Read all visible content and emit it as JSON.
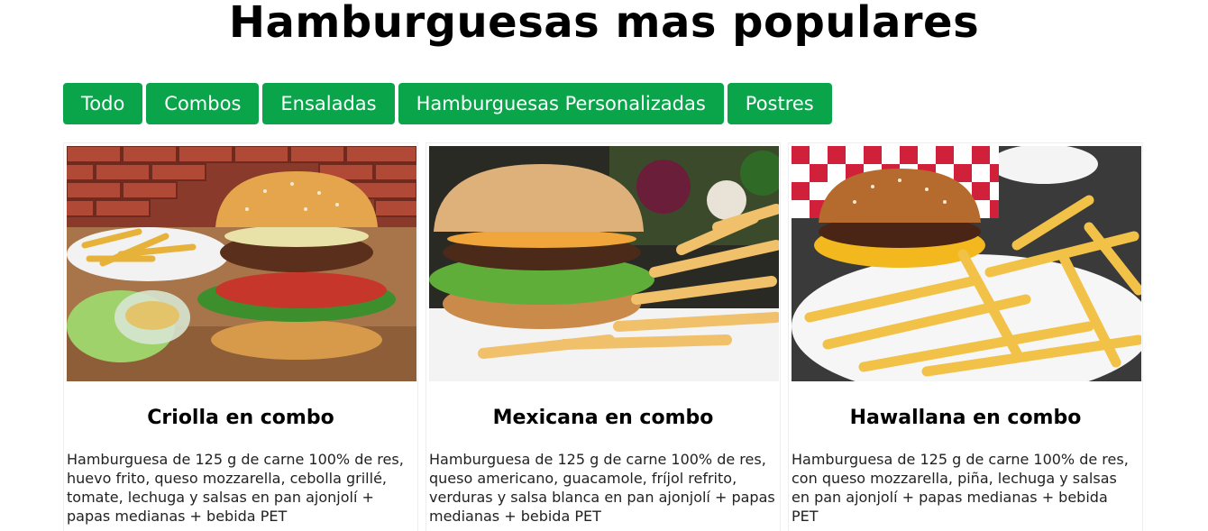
{
  "page": {
    "title": "Hamburguesas mas populares"
  },
  "filters": [
    {
      "label": "Todo"
    },
    {
      "label": "Combos"
    },
    {
      "label": "Ensaladas"
    },
    {
      "label": "Hamburguesas Personalizadas"
    },
    {
      "label": "Postres"
    }
  ],
  "cards": [
    {
      "title": "Criolla en combo",
      "description": "Hamburguesa de 125 g de carne 100% de res, huevo frito, queso mozzarella, cebolla grillé, tomate, lechuga y salsas en pan ajonjolí + papas medianas + bebida PET",
      "image": "burger-brick-wall-photo"
    },
    {
      "title": "Mexicana en combo",
      "description": "Hamburguesa de 125 g de carne 100% de res, queso americano, guacamole, fríjol refrito, verduras y salsa blanca en pan ajonjolí + papas medianas + bebida PET",
      "image": "burger-fries-photo"
    },
    {
      "title": "Hawallana en combo",
      "description": "Hamburguesa de 125 g de carne 100% de res, con queso mozzarella, piña, lechuga y salsas en pan ajonjolí + papas medianas + bebida PET",
      "image": "burger-checkered-paper-photo"
    }
  ],
  "colors": {
    "accent": "#0aa44b",
    "button_text": "#ffffff"
  }
}
